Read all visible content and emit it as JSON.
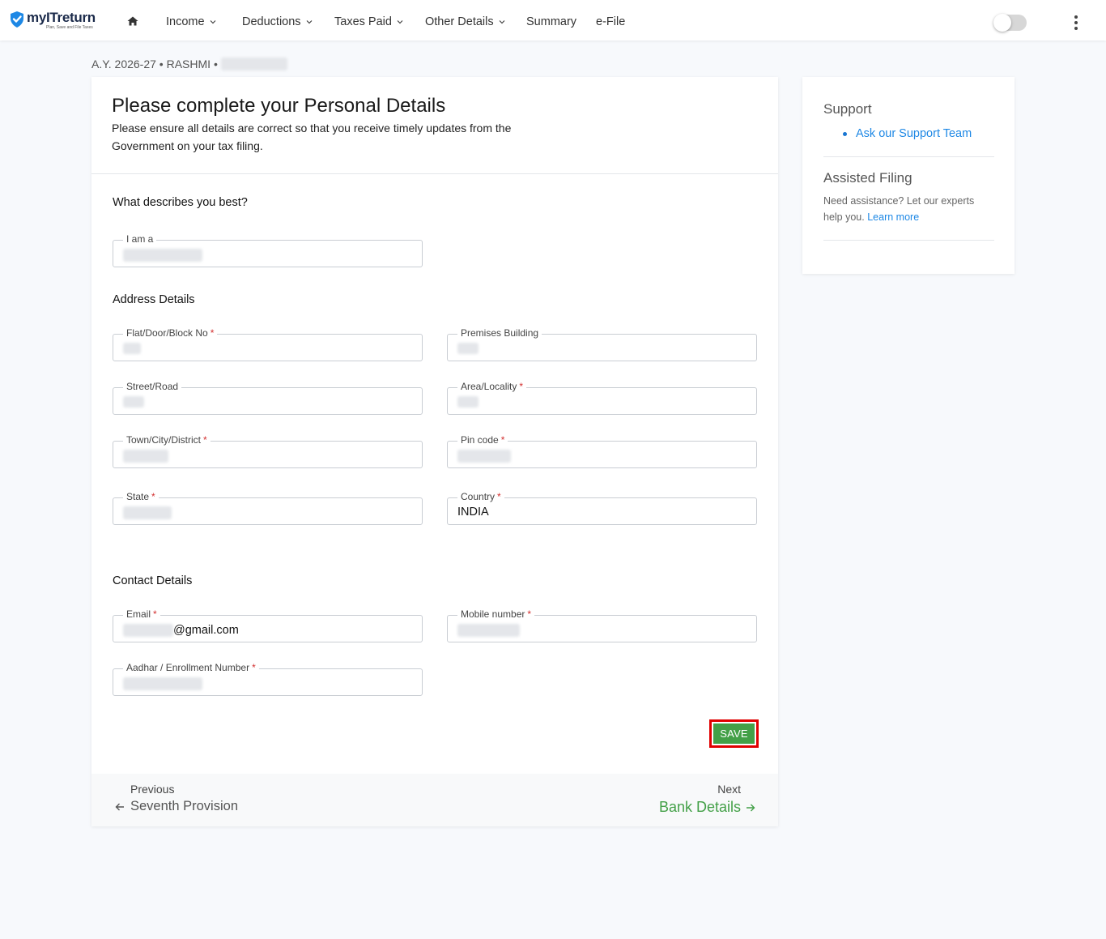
{
  "app": {
    "logo_name": "myITreturn",
    "logo_tagline": "Plan, Save and File Taxes"
  },
  "nav": {
    "items": [
      {
        "label": "Income",
        "dropdown": true
      },
      {
        "label": "Deductions",
        "dropdown": true
      },
      {
        "label": "Taxes Paid",
        "dropdown": true
      },
      {
        "label": "Other Details",
        "dropdown": true
      },
      {
        "label": "Summary",
        "dropdown": false
      },
      {
        "label": "e-File",
        "dropdown": false
      }
    ],
    "toggle_on": false
  },
  "context": {
    "line": "A.Y. 2026-27 • RASHMI •"
  },
  "header": {
    "title": "Please complete your Personal Details",
    "subtitle": "Please ensure all details are correct so that you receive timely updates from the Government on your tax filing."
  },
  "sections": {
    "describe": "What describes you best?",
    "address": "Address Details",
    "contact": "Contact Details"
  },
  "fields": {
    "iam": {
      "label": "I am a",
      "required": false,
      "value": ""
    },
    "flat": {
      "label": "Flat/Door/Block No",
      "required": true,
      "value": ""
    },
    "premises": {
      "label": "Premises Building",
      "required": false,
      "value": ""
    },
    "street": {
      "label": "Street/Road",
      "required": false,
      "value": ""
    },
    "area": {
      "label": "Area/Locality",
      "required": true,
      "value": ""
    },
    "town": {
      "label": "Town/City/District",
      "required": true,
      "value": ""
    },
    "pin": {
      "label": "Pin code",
      "required": true,
      "value": ""
    },
    "state": {
      "label": "State",
      "required": true,
      "value": ""
    },
    "country": {
      "label": "Country",
      "required": true,
      "value": "INDIA"
    },
    "email": {
      "label": "Email",
      "required": true,
      "value": "@gmail.com"
    },
    "mobile": {
      "label": "Mobile number",
      "required": true,
      "value": ""
    },
    "aadhar": {
      "label": "Aadhar / Enrollment Number",
      "required": true,
      "value": ""
    }
  },
  "actions": {
    "save_label": "SAVE"
  },
  "footer": {
    "previous_label": "Previous",
    "previous_target": "Seventh Provision",
    "next_label": "Next",
    "next_target": "Bank Details"
  },
  "sidebar": {
    "support_title": "Support",
    "support_link": "Ask our Support Team",
    "assisted_title": "Assisted Filing",
    "assisted_text": "Need assistance? Let our experts help you.",
    "assisted_link": "Learn more"
  },
  "colors": {
    "accent_green": "#43a047",
    "link_blue": "#1e88e5",
    "required_red": "#d32f2f",
    "highlight_red": "#e00000",
    "logo_blue": "#1e88e5"
  },
  "icons": [
    "check-shield-icon",
    "home-icon",
    "chevron-down-icon",
    "kebab-menu-icon",
    "arrow-left-icon",
    "arrow-right-icon"
  ]
}
